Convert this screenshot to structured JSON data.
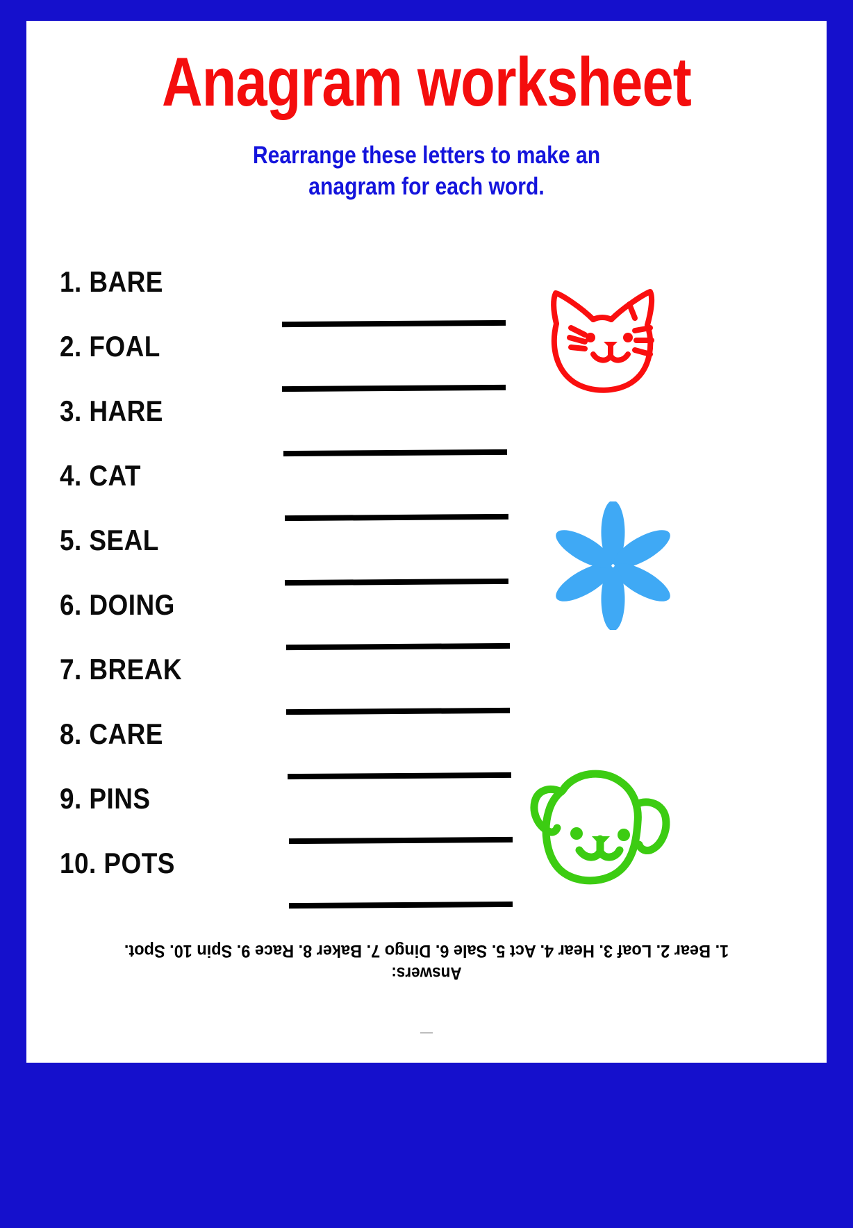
{
  "page": {
    "border_color": "#1510cc",
    "background_color": "#ffffff"
  },
  "header": {
    "title": "Anagram worksheet",
    "title_color": "#f40d0d",
    "subtitle_line1": "Rearrange these letters to make an",
    "subtitle_line2": "anagram for each word.",
    "subtitle_color": "#1414dc"
  },
  "items": [
    {
      "number": "1.",
      "word": "BARE"
    },
    {
      "number": "2.",
      "word": "FOAL"
    },
    {
      "number": "3.",
      "word": "HARE"
    },
    {
      "number": "4.",
      "word": "CAT"
    },
    {
      "number": "5.",
      "word": "SEAL"
    },
    {
      "number": "6.",
      "word": "DOING"
    },
    {
      "number": "7.",
      "word": "BREAK"
    },
    {
      "number": "8.",
      "word": "CARE"
    },
    {
      "number": "9.",
      "word": "PINS"
    },
    {
      "number": "10.",
      "word": "POTS"
    }
  ],
  "item_labels": [
    "1. BARE",
    "2. FOAL",
    "3. HARE",
    "4. CAT",
    "5. SEAL",
    "6. DOING",
    "7. BREAK",
    "8. CARE",
    "9. PINS",
    "10. POTS"
  ],
  "decorations": [
    {
      "name": "cat-face-doodle",
      "color": "#fa0f0f"
    },
    {
      "name": "flower-doodle",
      "color": "#3fa9f5"
    },
    {
      "name": "dog-face-doodle",
      "color": "#3ccc12"
    }
  ],
  "answers": {
    "label": "Answers:",
    "text": "1. Bear 2. Loaf 3. Hear 4. Act 5. Sale 6. Dingo 7. Baker 8. Race 9. Spin 10. Spot.",
    "entries": [
      {
        "number": "1.",
        "answer": "Bear"
      },
      {
        "number": "2.",
        "answer": "Loaf"
      },
      {
        "number": "3.",
        "answer": "Hear"
      },
      {
        "number": "4.",
        "answer": "Act"
      },
      {
        "number": "5.",
        "answer": "Sale"
      },
      {
        "number": "6.",
        "answer": "Dingo"
      },
      {
        "number": "7.",
        "answer": "Baker"
      },
      {
        "number": "8.",
        "answer": "Race"
      },
      {
        "number": "9.",
        "answer": "Spin"
      },
      {
        "number": "10.",
        "answer": "Spot."
      }
    ]
  }
}
